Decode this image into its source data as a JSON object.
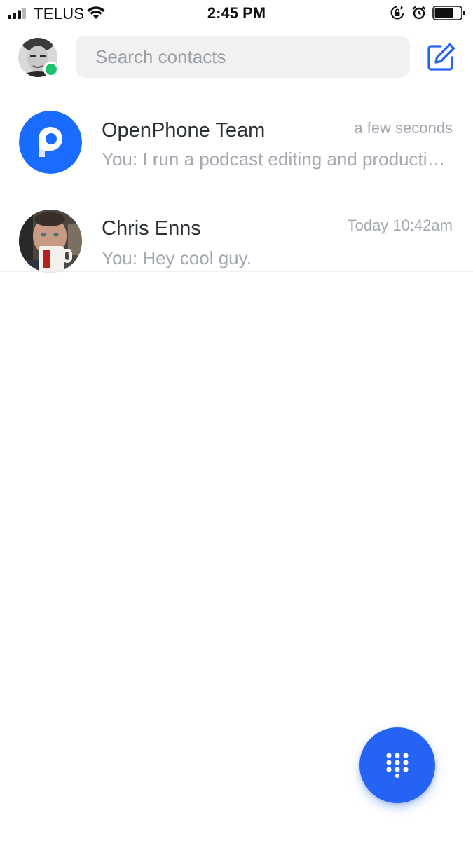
{
  "status_bar": {
    "carrier": "TELUS",
    "time": "2:45 PM",
    "icons": [
      "signal-icon",
      "wifi-icon",
      "rotation-lock-icon",
      "alarm-icon",
      "battery-icon"
    ]
  },
  "header": {
    "search_placeholder": "Search contacts",
    "presence_color": "#1ec26b",
    "compose_icon": "compose-icon"
  },
  "conversations": [
    {
      "name": "OpenPhone Team",
      "time": "a few seconds",
      "preview": "You: I run a podcast editing and production business",
      "avatar": "openphone-logo"
    },
    {
      "name": "Chris Enns",
      "time": "Today 10:42am",
      "preview": "You: Hey cool guy.",
      "avatar": "contact-photo"
    }
  ],
  "fab": {
    "icon": "dialpad-icon"
  },
  "colors": {
    "accent": "#2563f5",
    "muted_text": "#a3a8b0",
    "primary_text": "#2b3036",
    "online": "#1ec26b"
  }
}
